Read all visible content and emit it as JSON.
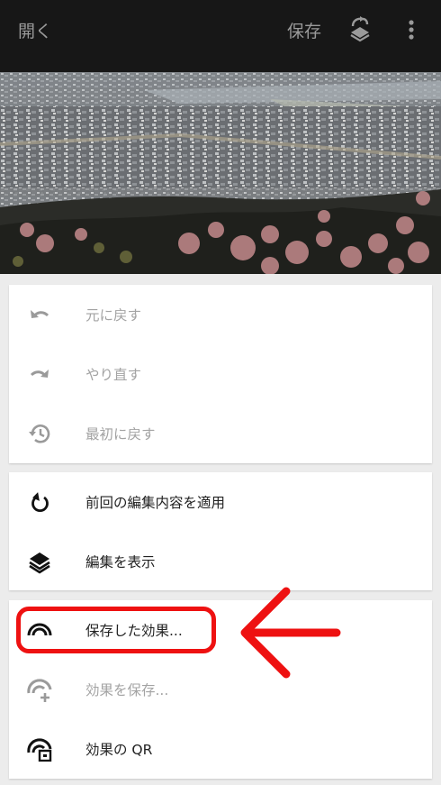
{
  "topbar": {
    "open_label": "開く",
    "save_label": "保存",
    "layers_icon": "layers-swap-icon",
    "more_icon": "more-vertical-icon"
  },
  "photo": {
    "description_icon": "landscape-photo"
  },
  "history_card": {
    "items": [
      {
        "label": "元に戻す",
        "icon": "undo-icon",
        "enabled": false
      },
      {
        "label": "やり直す",
        "icon": "redo-icon",
        "enabled": false
      },
      {
        "label": "最初に戻す",
        "icon": "history-icon",
        "enabled": false
      }
    ]
  },
  "edits_card": {
    "items": [
      {
        "label": "前回の編集内容を適用",
        "icon": "apply-previous-icon",
        "enabled": true
      },
      {
        "label": "編集を表示",
        "icon": "layers-icon",
        "enabled": true
      }
    ]
  },
  "looks_card": {
    "items": [
      {
        "label": "保存した効果...",
        "icon": "saved-looks-icon",
        "enabled": true
      },
      {
        "label": "効果を保存...",
        "icon": "save-look-icon",
        "enabled": false
      },
      {
        "label": "効果の QR",
        "icon": "qr-look-icon",
        "enabled": true
      }
    ]
  },
  "colors": {
    "topbar_bg": "#171717",
    "highlight": "#ee1111",
    "disabled_text": "#a3a3a3",
    "enabled_text": "#222222"
  }
}
